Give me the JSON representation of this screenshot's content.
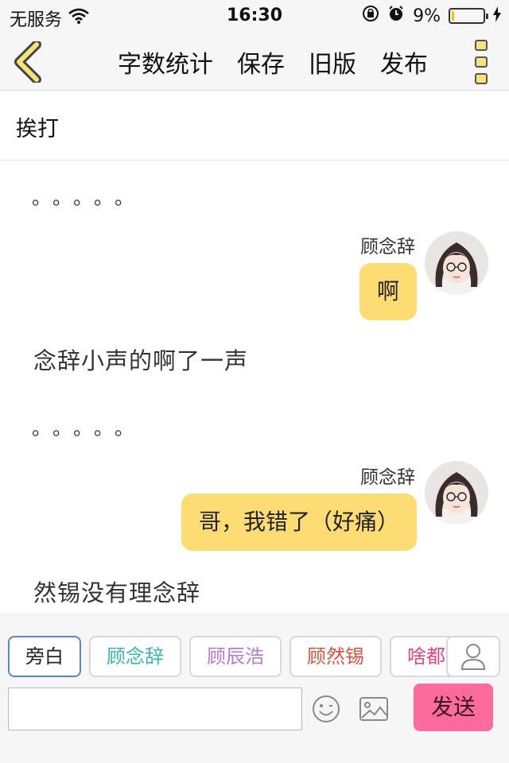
{
  "status_bar": {
    "carrier": "无服务",
    "time": "16:30",
    "battery_percent": "9%",
    "battery_level": 0.09,
    "icons": [
      "wifi-icon",
      "orientation-lock-icon",
      "alarm-icon",
      "battery-icon",
      "charging-icon"
    ]
  },
  "nav": {
    "back_icon": "chevron-left-icon",
    "actions": [
      "字数统计",
      "保存",
      "旧版",
      "发布"
    ],
    "more_icon": "more-vertical-icon"
  },
  "story": {
    "title": "挨打"
  },
  "chat": {
    "dots_1": "。。。。。",
    "msg_1": {
      "speaker": "顾念辞",
      "text": "啊"
    },
    "narration_1": "念辞小声的啊了一声",
    "dots_2": "。。。。。",
    "msg_2": {
      "speaker": "顾念辞",
      "text": "哥，我错了（好痛）"
    },
    "narration_2": "然锡没有理念辞"
  },
  "characters": [
    {
      "name": "旁白",
      "color": "#222222"
    },
    {
      "name": "顾念辞",
      "color": "#38b6b0"
    },
    {
      "name": "顾辰浩",
      "color": "#b67ad0"
    },
    {
      "name": "顾然锡",
      "color": "#d8533f"
    },
    {
      "name": "啥都",
      "color": "#e0457c"
    }
  ],
  "composer": {
    "placeholder": "",
    "send_label": "发送",
    "send_color": "#fd6a9c",
    "bubble_color": "#fedc74"
  }
}
